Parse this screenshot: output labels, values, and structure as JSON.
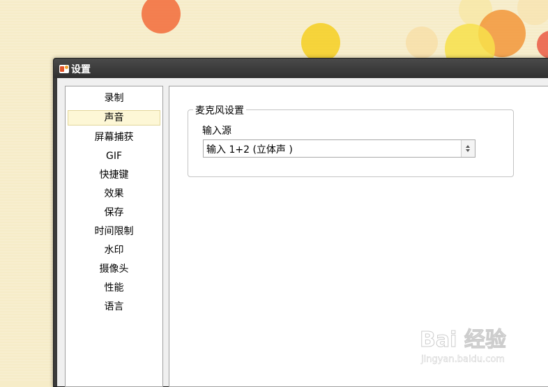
{
  "window": {
    "title": "设置"
  },
  "sidebar": {
    "items": [
      {
        "label": "录制",
        "selected": false
      },
      {
        "label": "声音",
        "selected": true
      },
      {
        "label": "屏幕捕获",
        "selected": false
      },
      {
        "label": "GIF",
        "selected": false
      },
      {
        "label": "快捷键",
        "selected": false
      },
      {
        "label": "效果",
        "selected": false
      },
      {
        "label": "保存",
        "selected": false
      },
      {
        "label": "时间限制",
        "selected": false
      },
      {
        "label": "水印",
        "selected": false
      },
      {
        "label": "摄像头",
        "selected": false
      },
      {
        "label": "性能",
        "selected": false
      },
      {
        "label": "语言",
        "selected": false
      }
    ]
  },
  "main": {
    "group_title": "麦克风设置",
    "input_source_label": "输入源",
    "input_source_value": "输入 1+2 (立体声 )"
  },
  "watermark": {
    "brand": "Bai 经验",
    "url": "jingyan.baidu.com"
  },
  "colors": {
    "wallpaper": "#f6ecc8",
    "selected_item_bg": "#fdf7d6",
    "titlebar": "#3a3a3a"
  }
}
